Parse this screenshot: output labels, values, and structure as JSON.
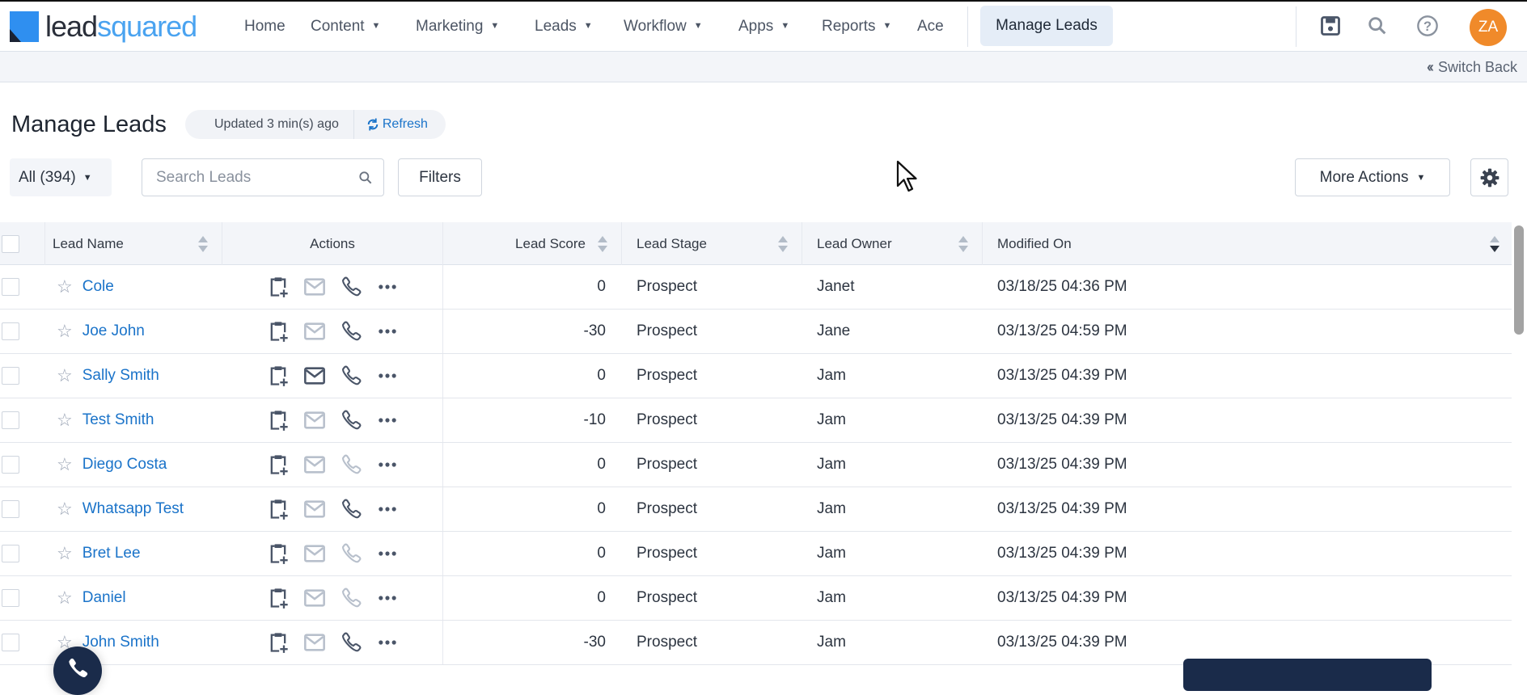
{
  "brand": {
    "name_part1": "lead",
    "name_part2": "squared"
  },
  "nav": {
    "items": [
      {
        "label": "Home",
        "caret": false
      },
      {
        "label": "Content",
        "caret": true
      },
      {
        "label": "Marketing",
        "caret": true
      },
      {
        "label": "Leads",
        "caret": true
      },
      {
        "label": "Workflow",
        "caret": true
      },
      {
        "label": "Apps",
        "caret": true
      },
      {
        "label": "Reports",
        "caret": true
      },
      {
        "label": "Ace",
        "caret": false
      }
    ],
    "active": "Manage Leads",
    "avatar": "ZA"
  },
  "switch_back": "Switch Back",
  "page": {
    "title": "Manage Leads",
    "updated": "Updated 3 min(s) ago",
    "refresh": "Refresh"
  },
  "toolbar": {
    "filter_view": "All (394)",
    "search_placeholder": "Search Leads",
    "filters": "Filters",
    "more_actions": "More Actions"
  },
  "table": {
    "headers": [
      "Lead Name",
      "Actions",
      "Lead Score",
      "Lead Stage",
      "Lead Owner",
      "Modified On"
    ],
    "rows": [
      {
        "name": "Cole",
        "score": "0",
        "stage": "Prospect",
        "owner": "Janet",
        "modified": "03/18/25 04:36 PM",
        "email_enabled": false,
        "phone_enabled": true
      },
      {
        "name": "Joe John",
        "score": "-30",
        "stage": "Prospect",
        "owner": "Jane",
        "modified": "03/13/25 04:59 PM",
        "email_enabled": false,
        "phone_enabled": true
      },
      {
        "name": "Sally Smith",
        "score": "0",
        "stage": "Prospect",
        "owner": "Jam",
        "modified": "03/13/25 04:39 PM",
        "email_enabled": true,
        "phone_enabled": true
      },
      {
        "name": "Test Smith",
        "score": "-10",
        "stage": "Prospect",
        "owner": "Jam",
        "modified": "03/13/25 04:39 PM",
        "email_enabled": false,
        "phone_enabled": true
      },
      {
        "name": "Diego Costa",
        "score": "0",
        "stage": "Prospect",
        "owner": "Jam",
        "modified": "03/13/25 04:39 PM",
        "email_enabled": false,
        "phone_enabled": false
      },
      {
        "name": "Whatsapp Test",
        "score": "0",
        "stage": "Prospect",
        "owner": "Jam",
        "modified": "03/13/25 04:39 PM",
        "email_enabled": false,
        "phone_enabled": true
      },
      {
        "name": "Bret Lee",
        "score": "0",
        "stage": "Prospect",
        "owner": "Jam",
        "modified": "03/13/25 04:39 PM",
        "email_enabled": false,
        "phone_enabled": false
      },
      {
        "name": "Daniel",
        "score": "0",
        "stage": "Prospect",
        "owner": "Jam",
        "modified": "03/13/25 04:39 PM",
        "email_enabled": false,
        "phone_enabled": false
      },
      {
        "name": "John Smith",
        "score": "-30",
        "stage": "Prospect",
        "owner": "Jam",
        "modified": "03/13/25 04:39 PM",
        "email_enabled": false,
        "phone_enabled": true
      }
    ]
  },
  "colors": {
    "accent": "#1a73c9",
    "avatar": "#f08a2a",
    "navy": "#1a2b4a",
    "icon_active": "#4a5568",
    "icon_disabled": "#b8c0cc"
  }
}
